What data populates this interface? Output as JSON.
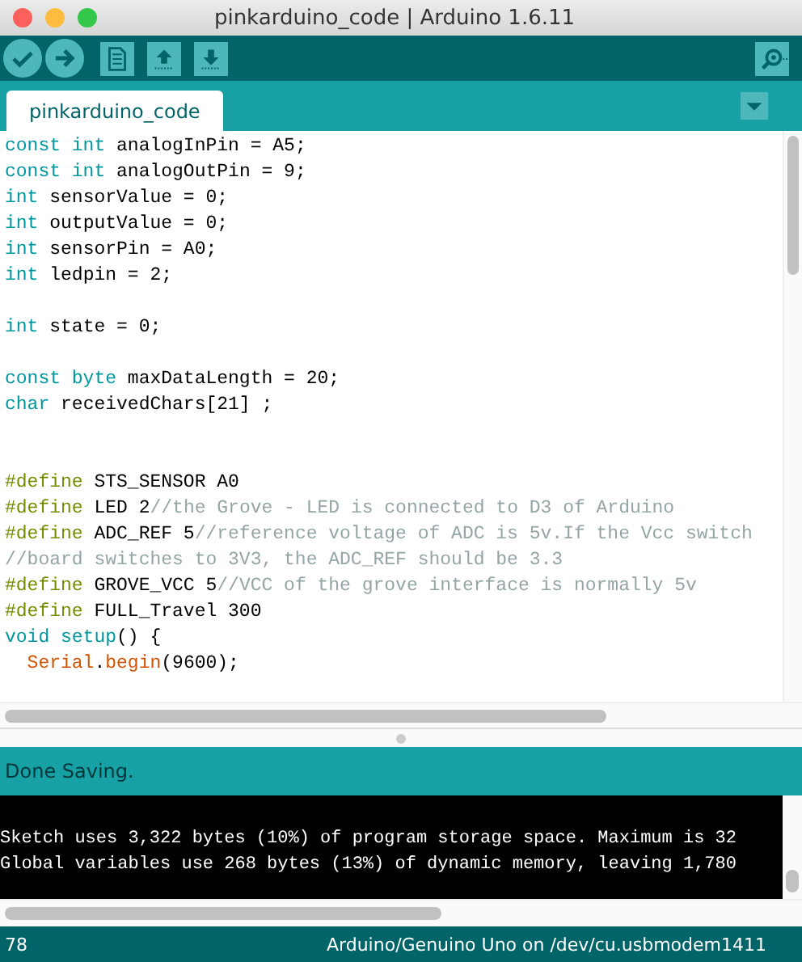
{
  "window": {
    "title": "pinkarduino_code | Arduino 1.6.11"
  },
  "tabs": [
    {
      "label": "pinkarduino_code",
      "selected": true
    }
  ],
  "editor": {
    "lines": [
      {
        "kind": "code",
        "tokens": [
          {
            "kind": "keyword",
            "text": "const int"
          },
          {
            "kind": "plain",
            "text": " analogInPin = A5;"
          }
        ]
      },
      {
        "kind": "code",
        "tokens": [
          {
            "kind": "keyword",
            "text": "const int"
          },
          {
            "kind": "plain",
            "text": " analogOutPin = 9;"
          }
        ]
      },
      {
        "kind": "code",
        "tokens": [
          {
            "kind": "keyword",
            "text": "int"
          },
          {
            "kind": "plain",
            "text": " sensorValue = 0;"
          }
        ]
      },
      {
        "kind": "code",
        "tokens": [
          {
            "kind": "keyword",
            "text": "int"
          },
          {
            "kind": "plain",
            "text": " outputValue = 0;"
          }
        ]
      },
      {
        "kind": "code",
        "tokens": [
          {
            "kind": "keyword",
            "text": "int"
          },
          {
            "kind": "plain",
            "text": " sensorPin = A0;"
          }
        ]
      },
      {
        "kind": "code",
        "tokens": [
          {
            "kind": "keyword",
            "text": "int"
          },
          {
            "kind": "plain",
            "text": " ledpin = 2;"
          }
        ]
      },
      {
        "kind": "blank"
      },
      {
        "kind": "code",
        "tokens": [
          {
            "kind": "keyword",
            "text": "int"
          },
          {
            "kind": "plain",
            "text": " state = 0;"
          }
        ]
      },
      {
        "kind": "blank"
      },
      {
        "kind": "code",
        "tokens": [
          {
            "kind": "keyword",
            "text": "const byte"
          },
          {
            "kind": "plain",
            "text": " maxDataLength = 20;"
          }
        ]
      },
      {
        "kind": "code",
        "tokens": [
          {
            "kind": "keyword",
            "text": "char"
          },
          {
            "kind": "plain",
            "text": " receivedChars[21] ;"
          }
        ]
      },
      {
        "kind": "blank"
      },
      {
        "kind": "blank"
      },
      {
        "kind": "code",
        "tokens": [
          {
            "kind": "preproc",
            "text": "#define"
          },
          {
            "kind": "plain",
            "text": " STS_SENSOR A0"
          }
        ]
      },
      {
        "kind": "code",
        "tokens": [
          {
            "kind": "preproc",
            "text": "#define"
          },
          {
            "kind": "plain",
            "text": " LED 2"
          },
          {
            "kind": "comment",
            "text": "//the Grove - LED is connected to D3 of Arduino"
          }
        ]
      },
      {
        "kind": "code",
        "tokens": [
          {
            "kind": "preproc",
            "text": "#define"
          },
          {
            "kind": "plain",
            "text": " ADC_REF 5"
          },
          {
            "kind": "comment",
            "text": "//reference voltage of ADC is 5v.If the Vcc switch"
          }
        ]
      },
      {
        "kind": "code",
        "tokens": [
          {
            "kind": "comment",
            "text": "//board switches to 3V3, the ADC_REF should be 3.3"
          }
        ]
      },
      {
        "kind": "code",
        "tokens": [
          {
            "kind": "preproc",
            "text": "#define"
          },
          {
            "kind": "plain",
            "text": " GROVE_VCC 5"
          },
          {
            "kind": "comment",
            "text": "//VCC of the grove interface is normally 5v"
          }
        ]
      },
      {
        "kind": "code",
        "tokens": [
          {
            "kind": "preproc",
            "text": "#define"
          },
          {
            "kind": "plain",
            "text": " FULL_Travel 300"
          }
        ]
      },
      {
        "kind": "code",
        "tokens": [
          {
            "kind": "keyword",
            "text": "void setup"
          },
          {
            "kind": "plain",
            "text": "() {"
          }
        ]
      },
      {
        "kind": "code",
        "tokens": [
          {
            "kind": "function",
            "text": "  Serial"
          },
          {
            "kind": "plain",
            "text": "."
          },
          {
            "kind": "function",
            "text": "begin"
          },
          {
            "kind": "plain",
            "text": "(9600);"
          }
        ]
      }
    ]
  },
  "message": "Done Saving.",
  "console": {
    "lines": [
      "Sketch uses 3,322 bytes (10%) of program storage space. Maximum is 32",
      "Global variables use 268 bytes (13%) of dynamic memory, leaving 1,780"
    ]
  },
  "status_bar": {
    "line": "78",
    "board": "Arduino/Genuino Uno on /dev/cu.usbmodem1411"
  }
}
